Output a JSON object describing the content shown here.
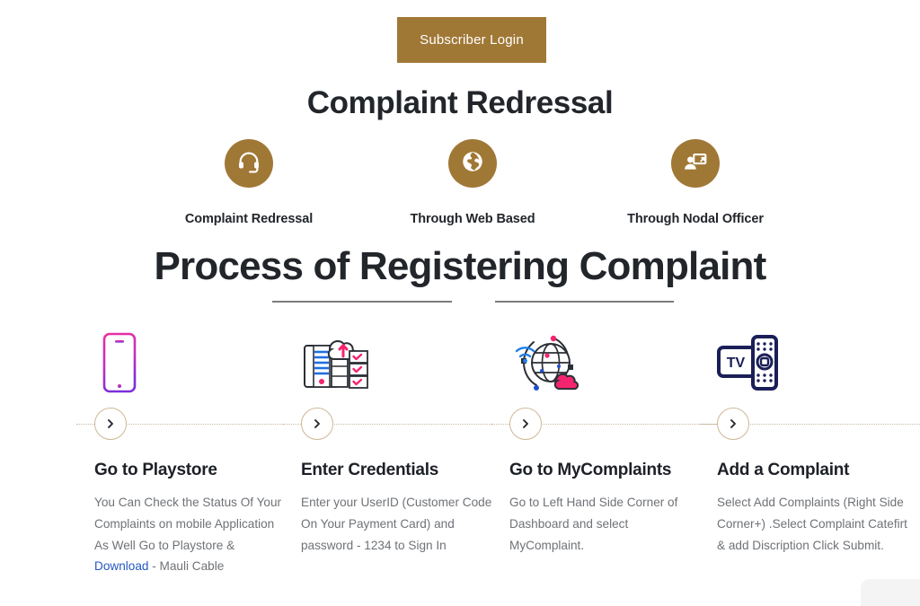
{
  "header": {
    "login_button": "Subscriber Login",
    "title": "Complaint Redressal"
  },
  "stepper": {
    "steps": [
      {
        "label": "Complaint Redressal",
        "icon": "headset-icon"
      },
      {
        "label": "Through Web Based",
        "icon": "globe-icon"
      },
      {
        "label": "Through Nodal Officer",
        "icon": "presentation-person-icon"
      }
    ],
    "circle_color": "#a07836",
    "line_color": "#7c7c7c"
  },
  "section": {
    "title": "Process of Registering Complaint"
  },
  "cards": [
    {
      "icon": "mobile-phone-icon",
      "arrow": "chevron-right-icon",
      "title": "Go to Playstore",
      "body_pre": "You Can Check the Status Of Your Complaints on mobile Application As Well\nGo to Playstore & ",
      "link_text": "Download",
      "body_post": " - Mauli Cable"
    },
    {
      "icon": "server-cloud-upload-icon",
      "arrow": "chevron-right-icon",
      "title": "Enter Credentials",
      "body": "Enter your UserID (Customer Code On Your Payment Card) and password - 1234 to Sign In"
    },
    {
      "icon": "globe-wifi-cloud-icon",
      "arrow": "chevron-right-icon",
      "title": "Go to MyComplaints",
      "body": "Go to Left Hand Side Corner of Dashboard and select MyComplaint."
    },
    {
      "icon": "tv-remote-icon",
      "arrow": "chevron-right-icon",
      "title": "Add a Complaint",
      "body": "Select Add Complaints (Right Side Corner+) .Select Complaint Catefirt & add Discription Click Submit."
    }
  ],
  "colors": {
    "brand_gold": "#a07836",
    "heading": "#22262b",
    "body_text": "#6f7277",
    "link_blue": "#2458c4",
    "rail_dot": "#c9bba4",
    "page_bg": "#ffffff"
  }
}
